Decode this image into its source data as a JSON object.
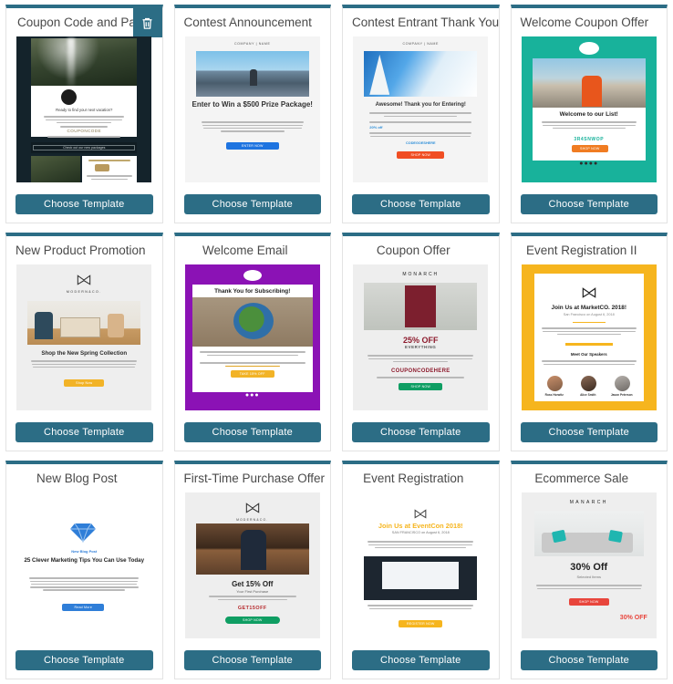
{
  "gallery": {
    "choose_label": "Choose Template",
    "delete_icon": "trash-icon",
    "accent_color": "#2c6d85",
    "cards": [
      {
        "title": "Coupon Code and Package",
        "has_delete": true,
        "preview": {
          "headline": "Ready to find your next vacation?",
          "code": "COUPONCODE",
          "bar_text": "Check out our new packages"
        }
      },
      {
        "title": "Contest Announcement",
        "has_delete": false,
        "preview": {
          "brand": "COMPANY | NAME",
          "headline": "Enter to Win a $500 Prize Package!",
          "body": "We're giving away a $500 Prize Package to one lucky winner! You can enter now until June 15th for the chance to win a $500 Prize Package which includes hiking boots, camping supplies and emergency survival gear.",
          "cta": "ENTER NOW"
        }
      },
      {
        "title": "Contest Entrant Thank You",
        "has_delete": false,
        "preview": {
          "brand": "COMPANY | NAME",
          "headline": "Awesome! Thank you for Entering!",
          "link": "20% off",
          "code_link": "CODEGOESHERE",
          "cta": "SHOP NOW"
        }
      },
      {
        "title": "Welcome Coupon Offer",
        "has_delete": false,
        "preview": {
          "headline": "Welcome to our List!",
          "code": "3R4SNWOP",
          "cta": "SHOP NOW",
          "social": "●●●●"
        }
      },
      {
        "title": "New Product Promotion",
        "has_delete": false,
        "preview": {
          "brand": "MODERN&CO.",
          "headline": "Shop the New Spring Collection",
          "cta": "Shop Now"
        }
      },
      {
        "title": "Welcome Email",
        "has_delete": false,
        "preview": {
          "headline": "Thank You for Subscribing!",
          "cta": "TAKE 15% OFF",
          "social": "●●●"
        }
      },
      {
        "title": "Coupon Offer",
        "has_delete": false,
        "preview": {
          "brand": "MONARCH",
          "headline": "25% OFF",
          "subhead": "EVERYTHING",
          "code": "COUPONCODEHERE",
          "cta": "SHOP NOW"
        }
      },
      {
        "title": "Event Registration II",
        "has_delete": false,
        "preview": {
          "headline": "Join Us at MarketCO. 2018!",
          "subhead": "San Francisco on August 6, 2018",
          "section": "Meet Our Speakers",
          "speakers": [
            "Ross Horwitz",
            "Alice Smith",
            "Jason Peterson"
          ]
        }
      },
      {
        "title": "New Blog Post",
        "has_delete": false,
        "preview": {
          "kicker": "New Blog Post",
          "headline": "25 Clever Marketing Tips You Can Use Today",
          "cta": "Read More"
        }
      },
      {
        "title": "First-Time Purchase Offer",
        "has_delete": false,
        "preview": {
          "brand": "MODERN&CO.",
          "headline": "Get 15% Off",
          "subhead": "Your First Purchase",
          "code": "GET15OFF",
          "cta": "SHOP NOW"
        }
      },
      {
        "title": "Event Registration",
        "has_delete": false,
        "preview": {
          "headline": "Join Us at EventCon 2018!",
          "subhead": "SAN FRANCISCO on August 6, 2018",
          "cta": "REGISTER NOW"
        }
      },
      {
        "title": "Ecommerce Sale",
        "has_delete": false,
        "preview": {
          "brand": "MANARCH",
          "headline": "30% Off",
          "subhead": "Selected Items",
          "cta": "SHOP NOW",
          "badge": "30% OFF"
        }
      }
    ]
  }
}
